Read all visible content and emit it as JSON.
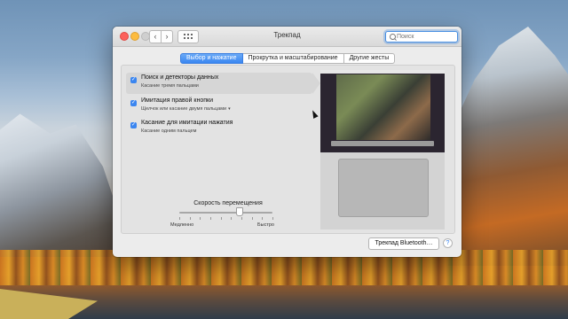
{
  "window": {
    "title": "Трекпад"
  },
  "search": {
    "placeholder": "Поиск"
  },
  "tabs": [
    {
      "label": "Выбор и нажатие",
      "active": true
    },
    {
      "label": "Прокрутка и масштабирование",
      "active": false
    },
    {
      "label": "Другие жесты",
      "active": false
    }
  ],
  "options": [
    {
      "title": "Поиск и детекторы данных",
      "subtitle": "Касание тремя пальцами",
      "checked": true
    },
    {
      "title": "Имитация правой кнопки",
      "subtitle": "Щелчок или касание двумя пальцами",
      "checked": true,
      "has_dropdown": true
    },
    {
      "title": "Касание для имитации нажатия",
      "subtitle": "Касание одним пальцем",
      "checked": true
    }
  ],
  "speed": {
    "label": "Скорость перемещения",
    "min_label": "Медленно",
    "max_label": "Быстро",
    "value": 0.65
  },
  "buttons": {
    "bluetooth": "Трекпад Bluetooth…",
    "help": "?"
  },
  "colors": {
    "accent": "#3b86f0"
  }
}
